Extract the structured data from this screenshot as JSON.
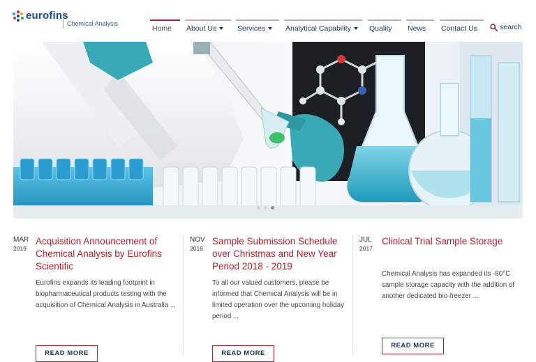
{
  "brand": {
    "name": "eurofins",
    "division": "Chemical Analysis"
  },
  "nav": {
    "items": [
      {
        "label": "Home",
        "has_dropdown": false,
        "active": true
      },
      {
        "label": "About Us",
        "has_dropdown": true
      },
      {
        "label": "Services",
        "has_dropdown": true
      },
      {
        "label": "Analytical Capability",
        "has_dropdown": true
      },
      {
        "label": "Quality",
        "has_dropdown": false
      },
      {
        "label": "News",
        "has_dropdown": false
      },
      {
        "label": "Contact Us",
        "has_dropdown": false
      }
    ],
    "search_label": "search"
  },
  "hero": {
    "slides": 3,
    "active_slide": 3
  },
  "news": [
    {
      "month": "MAR",
      "year": "2019",
      "title": "Acquisition Announcement of Chemical Analysis by Eurofins Scientific",
      "excerpt": "Eurofins expands its leading footprint in biopharmaceutical products testing with the acquisition of Chemical Analysis in Australia ...",
      "button": "READ MORE"
    },
    {
      "month": "NOV",
      "year": "2018",
      "title": "Sample Submission Schedule over Christmas and New Year Period 2018 - 2019",
      "excerpt": "To all our valued customers, please be informed that Chemical Analysis will be in limited operation over the upcoming holiday period ...",
      "button": "READ MORE"
    },
    {
      "month": "JUL",
      "year": "2017",
      "title": "Clinical Trial Sample Storage",
      "excerpt": "Chemical Analysis has expanded its -80°C sample storage capacity with the addition of another dedicated bio-freezer ...",
      "button": "READ MORE"
    }
  ],
  "colors": {
    "accent": "#b3202c",
    "navy": "#1d3556",
    "brand_blue": "#1a4a8a"
  }
}
